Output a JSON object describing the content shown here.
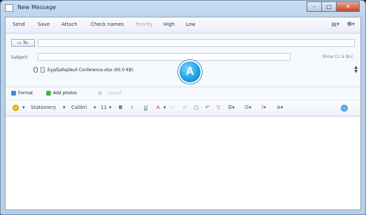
{
  "window": {
    "title": "New Message",
    "controls": {
      "minimize": "–",
      "maximize": "□",
      "close": "✕"
    }
  },
  "toolbar": {
    "send": "Send",
    "save": "Save",
    "attach": "Attach",
    "check_names": "Check names",
    "priority": "Priority",
    "high": "High",
    "low": "Low"
  },
  "header": {
    "to_label": "To:",
    "subject_label": "Subject:",
    "show_cc": "Show Cc & Bcc",
    "attachment": "Eyjafjallajökull Conference.xlsx (65.0 KB)",
    "scroll_up": "▲",
    "scroll_down": "▼"
  },
  "callout": {
    "label": "A"
  },
  "insert_bar": {
    "format": "Format",
    "add_photos": "Add photos",
    "layout": "Layout"
  },
  "format_bar": {
    "stationery": "Stationery",
    "font": "Calibri",
    "size": "11",
    "bold": "B",
    "italic": "I",
    "underline": "U",
    "font_color": "A"
  },
  "colors": {
    "callout": "#1b9ee6",
    "window_frame": "#b8cfe8",
    "close_button": "#c7432b"
  }
}
